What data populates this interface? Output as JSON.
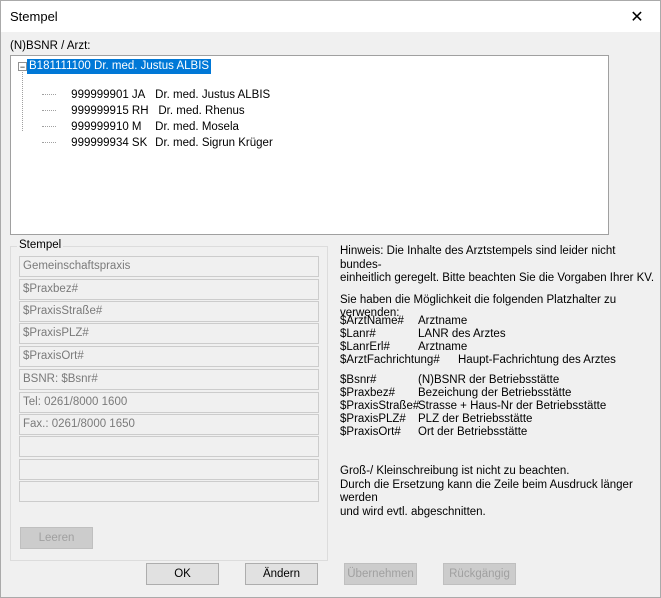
{
  "window": {
    "title": "Stempel",
    "close_symbol": "✕"
  },
  "bsnr_label": "(N)BSNR / Arzt:",
  "tree": {
    "root": {
      "expander": "−",
      "label": "B181111100 Dr. med. Justus ALBIS"
    },
    "children": [
      {
        "code": "999999901 JA",
        "name": "Dr. med. Justus ALBIS"
      },
      {
        "code": "999999915 RH",
        "name": " Dr. med. Rhenus"
      },
      {
        "code": "999999910 M",
        "name": "Dr. med. Mosela"
      },
      {
        "code": "999999934 SK",
        "name": "Dr. med. Sigrun Krüger"
      }
    ]
  },
  "stempel": {
    "group_label": "Stempel",
    "lines": [
      "Gemeinschaftspraxis",
      "$Praxbez#",
      "$PraxisStraße#",
      "$PraxisPLZ#",
      "$PraxisOrt#",
      "BSNR: $Bsnr#",
      "Tel: 0261/8000 1600",
      "Fax.: 0261/8000 1650",
      "",
      "",
      ""
    ],
    "clear_button": "Leeren"
  },
  "hint": {
    "line1": "Hinweis: Die Inhalte des Arztstempels sind leider nicht bundes-",
    "line2": "einheitlich geregelt. Bitte beachten Sie die Vorgaben Ihrer KV.",
    "line3": "Sie haben die Möglichkeit die folgenden Platzhalter zu verwenden:"
  },
  "placeholders_doctor": [
    {
      "key": "$ArztName#",
      "value": "Arztname"
    },
    {
      "key": "$Lanr#",
      "value": "LANR des Arztes"
    },
    {
      "key": "$LanrErl#",
      "value": "Arztname"
    },
    {
      "key": "$ArztFachrichtung#",
      "value": "Haupt-Fachrichtung des Arztes"
    }
  ],
  "placeholders_practice": [
    {
      "key": "$Bsnr#",
      "value": "(N)BSNR der Betriebsstätte"
    },
    {
      "key": "$Praxbez#",
      "value": "Bezeichung der Betriebsstätte"
    },
    {
      "key": "$PraxisStraße#",
      "value": "Strasse + Haus-Nr der Betriebsstätte"
    },
    {
      "key": "$PraxisPLZ#",
      "value": "PLZ der Betriebsstätte"
    },
    {
      "key": "$PraxisOrt#",
      "value": "Ort der Betriebsstätte"
    }
  ],
  "note": {
    "line1": "Groß-/ Kleinschreibung ist nicht zu beachten.",
    "line2": "Durch die Ersetzung kann die Zeile beim Ausdruck länger werden",
    "line3": "und wird evtl. abgeschnitten."
  },
  "buttons": {
    "ok": "OK",
    "change": "Ändern",
    "apply": "Übernehmen",
    "undo": "Rückgängig"
  }
}
